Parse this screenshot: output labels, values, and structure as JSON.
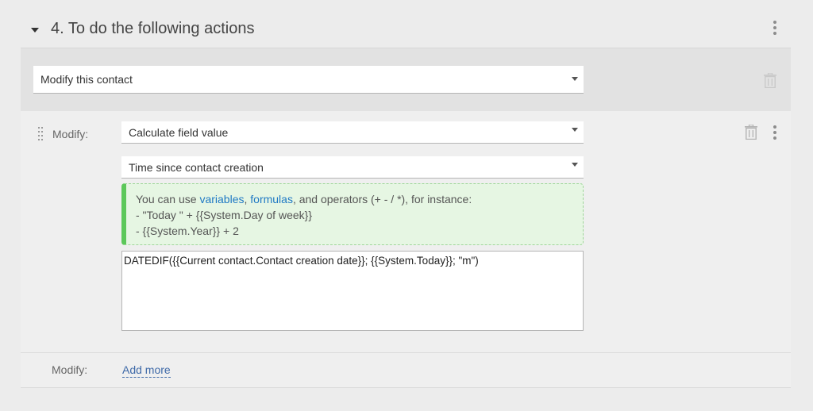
{
  "section": {
    "title": "4. To do the following actions"
  },
  "action": {
    "selected": "Modify this contact"
  },
  "modify_block": {
    "label": "Modify:",
    "method_selected": "Calculate field value",
    "field_selected": "Time since contact creation",
    "hint": {
      "prefix": "You can use ",
      "link_variables": "variables",
      "sep1": ", ",
      "link_formulas": "formulas",
      "suffix": ", and operators (+ - / *), for instance:",
      "example1": "- \"Today \" + {{System.Day of week}}",
      "example2": "- {{System.Year}} + 2"
    },
    "formula_value": "DATEDIF({{Current contact.Contact creation date}}; {{System.Today}}; \"m\")"
  },
  "footer": {
    "label": "Modify:",
    "add_more": "Add more"
  },
  "colors": {
    "hint_bar": "#5cc85a",
    "link": "#1f79c4",
    "add_more": "#3f6aa8"
  }
}
